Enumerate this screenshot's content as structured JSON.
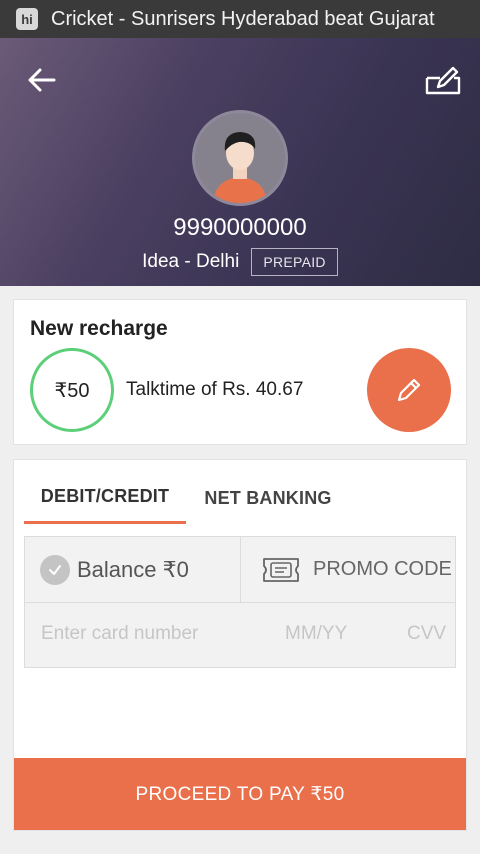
{
  "notification": {
    "app_icon_label": "hi",
    "text": "Cricket - Sunrisers Hyderabad beat Gujarat"
  },
  "header": {
    "phone_number": "9990000000",
    "operator": "Idea - Delhi",
    "plan_type": "PREPAID"
  },
  "recharge": {
    "title": "New recharge",
    "amount": "₹50",
    "talktime": "Talktime of Rs. 40.67"
  },
  "payment": {
    "tabs": [
      {
        "label": "DEBIT/CREDIT",
        "active": true
      },
      {
        "label": "NET BANKING",
        "active": false
      }
    ],
    "balance": "Balance ₹0",
    "promo_label": "PROMO CODE",
    "card_placeholder": "Enter card number",
    "expiry_placeholder": "MM/YY",
    "cvv_placeholder": "CVV",
    "proceed_label": "PROCEED TO PAY ₹50"
  },
  "colors": {
    "accent": "#e9704b",
    "amount_ring": "#5ccf78",
    "header_gradient": [
      "#6b5a78",
      "#2e2c44"
    ]
  },
  "icons": {
    "back": "arrow-left-icon",
    "edit_profile": "edit-note-icon",
    "avatar": "user-avatar-icon",
    "edit_amount": "pencil-icon",
    "balance_check": "check-icon",
    "promo": "ticket-icon"
  }
}
